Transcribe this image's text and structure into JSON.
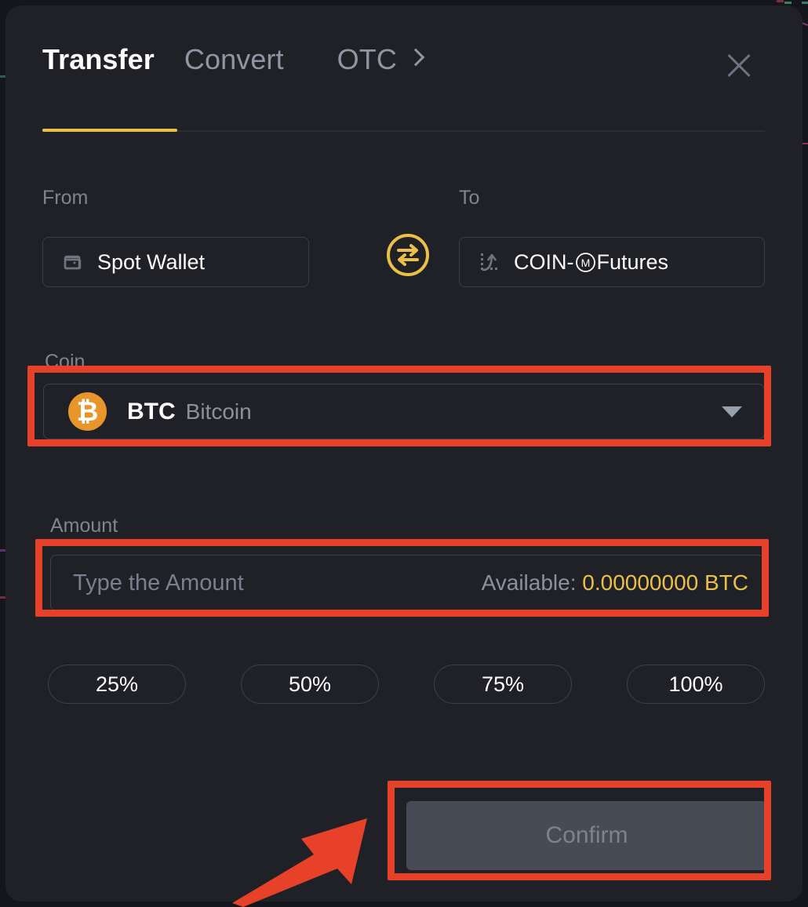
{
  "modal": {
    "tabs": [
      {
        "label": "Transfer",
        "active": true
      },
      {
        "label": "Convert",
        "active": false
      },
      {
        "label": "OTC",
        "active": false
      }
    ],
    "close_label": "×",
    "accent_color": "#eac046",
    "annotation_color": "#e8412a"
  },
  "transfer": {
    "from_label": "From",
    "from_value": "Spot Wallet",
    "to_label": "To",
    "to_value_prefix": "COIN-",
    "to_value_badge": "M",
    "to_value_suffix": " Futures",
    "swap_icon": "swap-arrows-icon",
    "coin_label": "Coin",
    "coin_symbol": "BTC",
    "coin_name": "Bitcoin",
    "coin_logo_glyph": "₿",
    "coin_logo_color": "#e8962c",
    "amount_label": "Amount",
    "amount_value": "",
    "amount_placeholder": "Type the Amount",
    "available_prefix": "Available: ",
    "available_value": "0.00000000 BTC",
    "percent_options": [
      "25%",
      "50%",
      "75%",
      "100%"
    ],
    "confirm_label": "Confirm"
  }
}
